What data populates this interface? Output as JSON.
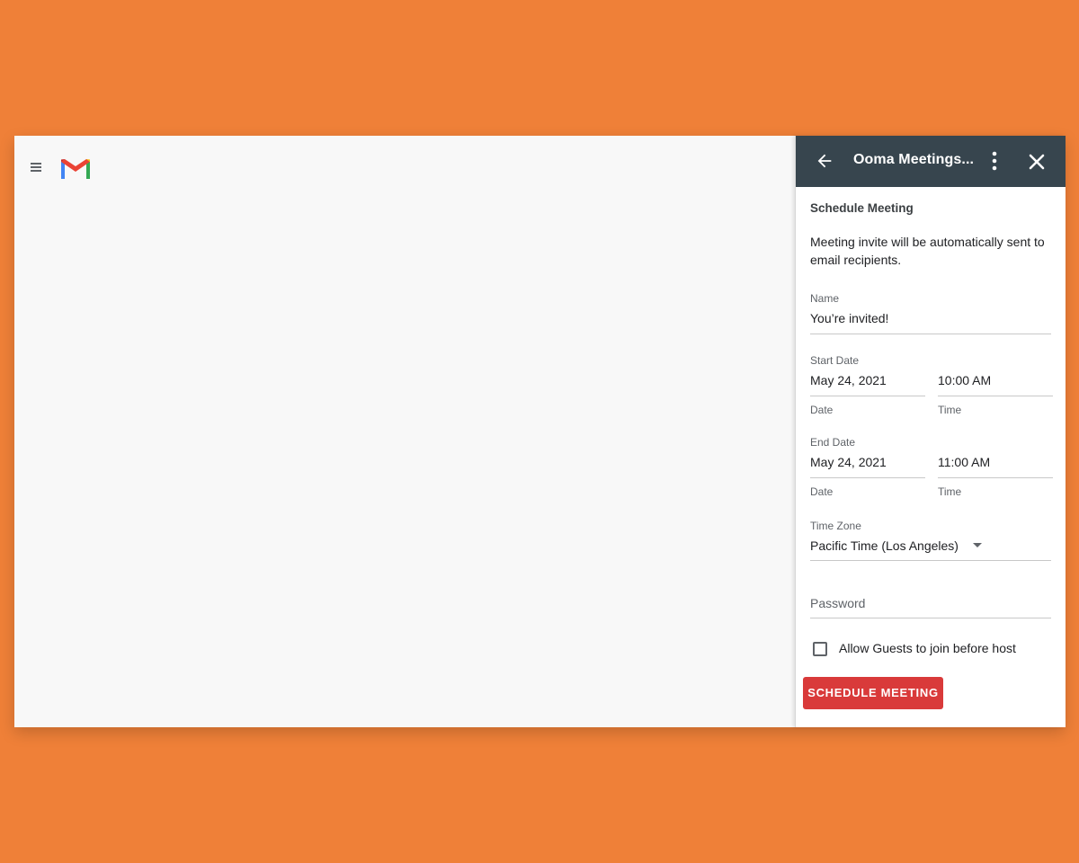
{
  "colors": {
    "background": "#EF8038",
    "header": "#37454E",
    "button": "#D93A3A"
  },
  "gmail": {
    "menu_icon": "hamburger-menu-icon",
    "logo_icon": "gmail-logo-icon"
  },
  "panel": {
    "header": {
      "back_icon": "arrow-back-icon",
      "title": "Ooma Meetings...",
      "more_icon": "more-vert-icon",
      "close_icon": "close-icon"
    },
    "section_title": "Schedule Meeting",
    "description": "Meeting invite will be automatically sent to email recipients.",
    "name": {
      "label": "Name",
      "value": "You’re invited!"
    },
    "start": {
      "label": "Start Date",
      "date": "May 24, 2021",
      "time": "10:00 AM",
      "date_helper": "Date",
      "time_helper": "Time"
    },
    "end": {
      "label": "End Date",
      "date": "May 24, 2021",
      "time": "11:00 AM",
      "date_helper": "Date",
      "time_helper": "Time"
    },
    "timezone": {
      "label": "Time Zone",
      "value": "Pacific Time (Los Angeles)",
      "icon": "dropdown-arrow-icon"
    },
    "password": {
      "placeholder": "Password"
    },
    "allow_guests": {
      "label": "Allow Guests to join before host",
      "checked": false
    },
    "schedule_button": "SCHEDULE MEETING"
  }
}
